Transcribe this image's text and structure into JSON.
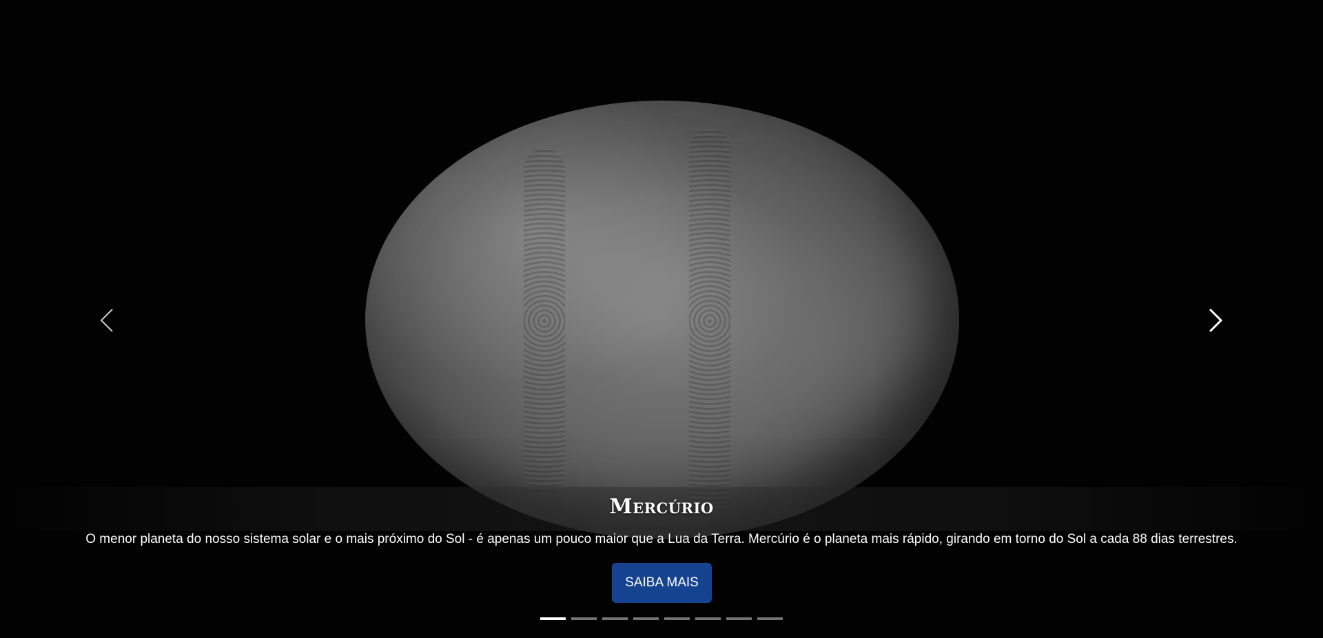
{
  "carousel": {
    "slide": {
      "title": "Mercúrio",
      "description": "O menor planeta do nosso sistema solar e o mais próximo do Sol - é apenas um pouco maior que a Lua da Terra. Mercúrio é o planeta mais rápido, girando em torno do Sol a cada 88 dias terrestres.",
      "button_label": "SAIBA MAIS",
      "image": "mercury-planet-image"
    },
    "controls": {
      "prev_icon": "chevron-left-icon",
      "next_icon": "chevron-right-icon"
    },
    "indicators": {
      "count": 8,
      "active_index": 0
    }
  },
  "colors": {
    "background": "#020202",
    "button": "#16438f",
    "text": "#ffffff"
  }
}
